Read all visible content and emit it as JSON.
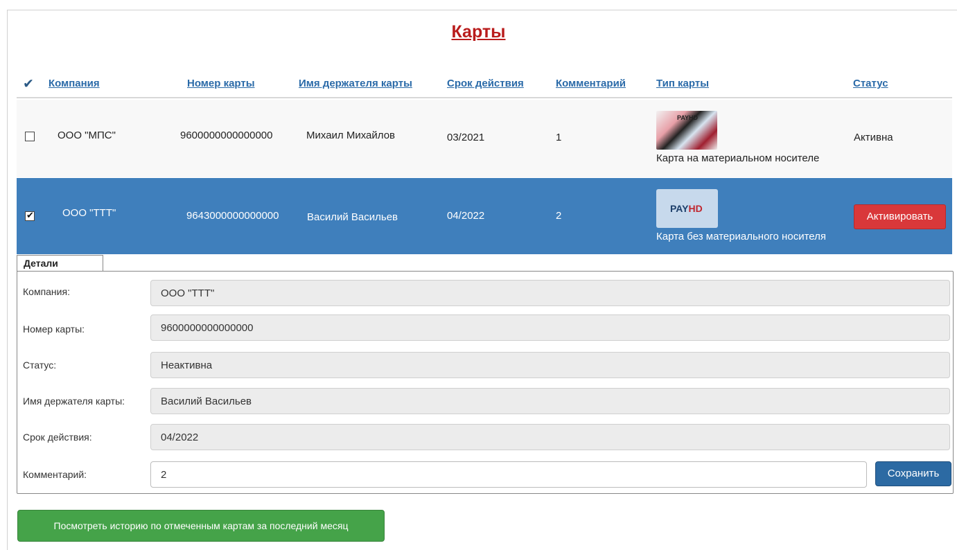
{
  "title": "Карты",
  "columns": {
    "check": "✔",
    "company": "Компания",
    "card_number": "Номер карты",
    "holder": "Имя держателя карты",
    "expiry": "Срок действия",
    "comment": "Комментарий",
    "card_type": "Тип карты",
    "status": "Статус"
  },
  "rows": [
    {
      "checked": false,
      "company": "ООО  \"МПС\"",
      "card_number": "9600000000000000",
      "holder": "Михаил Михайлов",
      "expiry": "03/2021",
      "comment": "1",
      "card_type": "Карта на материальном носителе",
      "card_logo": "PAYHD",
      "status": "Активна"
    },
    {
      "checked": true,
      "company": "ООО  \"ТТТ\"",
      "card_number": "9643000000000000",
      "holder": "Василий Васильев",
      "expiry": "04/2022",
      "comment": "2",
      "card_type": "Карта без материального носителя",
      "card_logo_a": "PAY",
      "card_logo_b": "HD",
      "action": "Активировать"
    }
  ],
  "details": {
    "tab": "Детали",
    "labels": {
      "company": "Компания:",
      "card_number": "Номер карты:",
      "status": "Статус:",
      "holder": "Имя держателя карты:",
      "expiry": "Срок действия:",
      "comment": "Комментарий:"
    },
    "values": {
      "company": "ООО \"ТТТ\"",
      "card_number": "9600000000000000",
      "status": "Неактивна",
      "holder": "Василий Васильев",
      "expiry": "04/2022",
      "comment": "2"
    },
    "save_label": "Сохранить"
  },
  "history_button": "Посмотреть историю по отмеченным картам за последний месяц",
  "colors": {
    "title": "#b91c1c",
    "selected_row": "#3f7fbc",
    "activate_button": "#d9383a",
    "save_button": "#2c6aa3",
    "history_button": "#45a349"
  }
}
